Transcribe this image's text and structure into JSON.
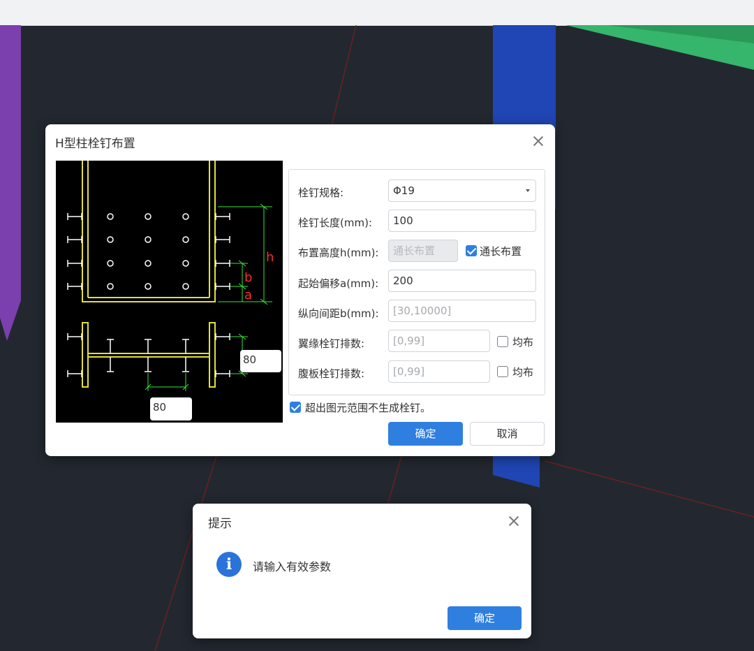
{
  "main_dialog": {
    "title": "H型柱栓钉布置",
    "fields": {
      "stud_spec": {
        "label": "栓钉规格:",
        "value": "Φ19"
      },
      "stud_length": {
        "label": "栓钉长度(mm):",
        "value": "100"
      },
      "layout_height": {
        "label": "布置高度h(mm):",
        "value": "通长布置",
        "checkbox_label": "通长布置",
        "checked": true
      },
      "start_offset": {
        "label": "起始偏移a(mm):",
        "value": "200"
      },
      "vertical_spacing": {
        "label": "纵向间距b(mm):",
        "placeholder": "[30,10000]"
      },
      "flange_rows": {
        "label": "翼缘栓钉排数:",
        "placeholder": "[0,99]",
        "checkbox_label": "均布",
        "checked": false
      },
      "web_rows": {
        "label": "腹板栓钉排数:",
        "placeholder": "[0,99]",
        "checkbox_label": "均布",
        "checked": false
      }
    },
    "outside_checkbox": {
      "label": "超出图元范围不生成栓钉。",
      "checked": true
    },
    "ok_label": "确定",
    "cancel_label": "取消",
    "diagram": {
      "labels": {
        "h": "h",
        "b": "b",
        "a": "a"
      },
      "flange_spacing": "80",
      "web_spacing": "80"
    }
  },
  "prompt_dialog": {
    "title": "提示",
    "message": "请输入有效参数",
    "ok_label": "确定",
    "icon": "info-icon"
  },
  "colors": {
    "background": "#232830",
    "accent": "#2f7fe0",
    "column_outline": "#e4e03a",
    "dimension_line": "#39e639",
    "dimension_label": "#ff2b2b"
  }
}
